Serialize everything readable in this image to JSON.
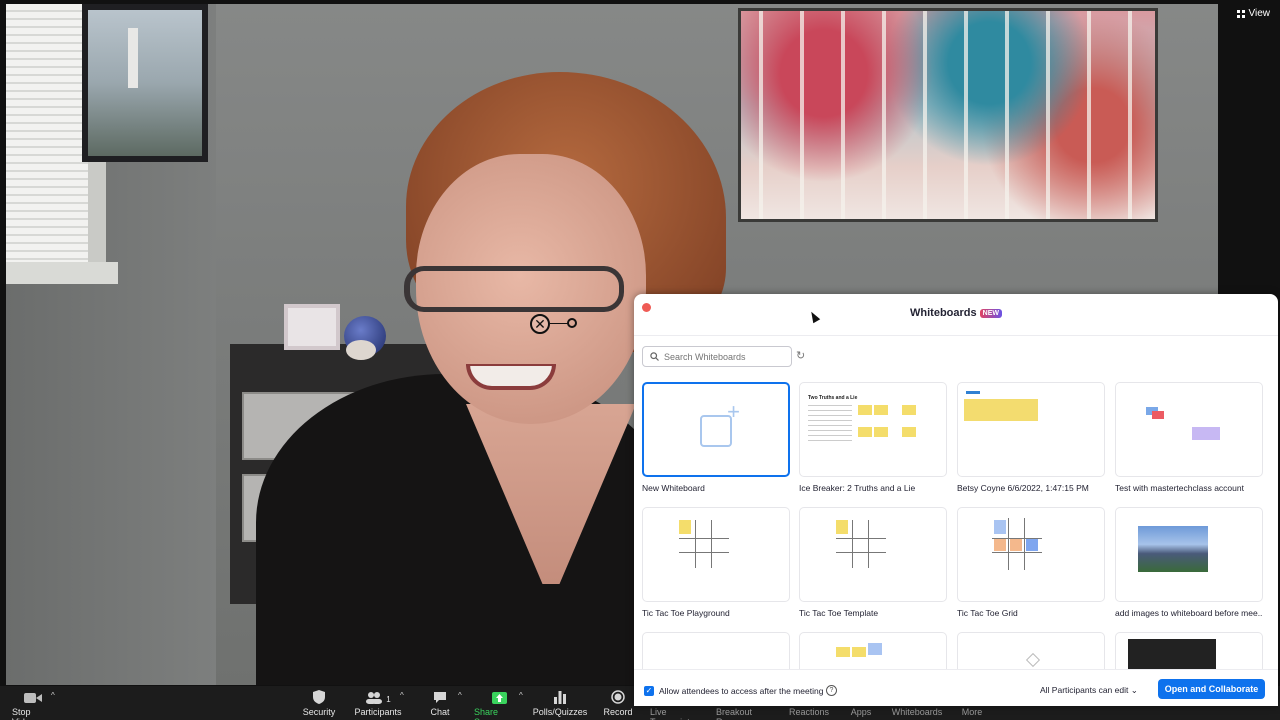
{
  "view": {
    "label": "View"
  },
  "toolbar": {
    "items": [
      {
        "label": "Stop Video",
        "icon": "video-camera-icon"
      },
      {
        "label": "Security",
        "icon": "shield-icon"
      },
      {
        "label": "Participants",
        "icon": "people-icon",
        "count": "1"
      },
      {
        "label": "Chat",
        "icon": "chat-bubble-icon"
      },
      {
        "label": "Share Screen",
        "icon": "share-arrow-icon"
      },
      {
        "label": "Polls/Quizzes",
        "icon": "bar-chart-icon"
      },
      {
        "label": "Record",
        "icon": "record-circle-icon"
      },
      {
        "label": "Live Transcript",
        "icon": "cc-icon"
      },
      {
        "label": "Breakout Rooms",
        "icon": "grid-icon"
      },
      {
        "label": "Reactions",
        "icon": "smile-icon"
      },
      {
        "label": "Apps",
        "icon": "apps-icon"
      },
      {
        "label": "Whiteboards",
        "icon": "whiteboard-icon"
      },
      {
        "label": "More",
        "icon": "ellipsis-icon"
      }
    ]
  },
  "whiteboards": {
    "title": "Whiteboards",
    "badge": "NEW",
    "search_placeholder": "Search Whiteboards",
    "items": [
      {
        "label": "New Whiteboard"
      },
      {
        "label": "Ice Breaker: 2 Truths and a Lie",
        "thumb_title": "Two Truths and a Lie"
      },
      {
        "label": "Betsy Coyne 6/6/2022, 1:47:15 PM"
      },
      {
        "label": "Test with mastertechclass account"
      },
      {
        "label": "Tic Tac Toe Playground"
      },
      {
        "label": "Tic Tac Toe Template"
      },
      {
        "label": "Tic Tac Toe Grid"
      },
      {
        "label": "add images to whiteboard before mee..."
      }
    ],
    "allow_label": "Allow attendees to access after the meeting",
    "permission": "All Participants can edit",
    "open_button": "Open and Collaborate",
    "accent": "#0e72ed"
  }
}
